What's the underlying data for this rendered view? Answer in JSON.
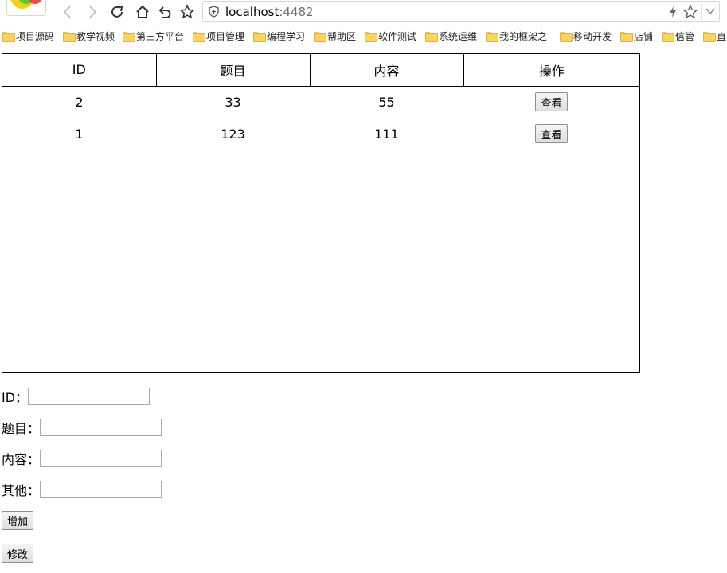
{
  "browser": {
    "url_host": "localhost",
    "url_port": ":4482",
    "bookmarks": [
      "项目源码",
      "教学视频",
      "第三方平台",
      "项目管理",
      "编程学习",
      "帮助区",
      "软件测试",
      "系统运维",
      "我的框架之",
      "移动开发",
      "店铺",
      "信管",
      "直"
    ]
  },
  "table": {
    "headers": [
      "ID",
      "题目",
      "内容",
      "操作"
    ],
    "rows": [
      {
        "id": "2",
        "title": "33",
        "content": "55",
        "action": "查看"
      },
      {
        "id": "1",
        "title": "123",
        "content": "111",
        "action": "查看"
      }
    ]
  },
  "form": {
    "id_label": "ID：",
    "title_label": "题目：",
    "content_label": "内容：",
    "other_label": "其他：",
    "id_value": "",
    "title_value": "",
    "content_value": "",
    "other_value": "",
    "add_label": "增加",
    "edit_label": "修改"
  }
}
